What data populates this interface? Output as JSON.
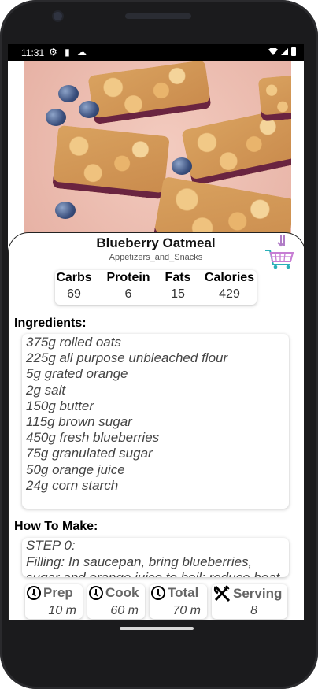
{
  "status": {
    "time": "11:31",
    "left_icons": "⚙ ▮ ☁"
  },
  "recipe": {
    "title": "Blueberry Oatmeal",
    "category": "Appetizers_and_Snacks"
  },
  "macros": [
    {
      "label": "Carbs",
      "value": "69"
    },
    {
      "label": "Protein",
      "value": "6"
    },
    {
      "label": "Fats",
      "value": "15"
    },
    {
      "label": "Calories",
      "value": "429"
    }
  ],
  "ingredients": {
    "heading": "Ingredients:",
    "items": [
      "375g rolled oats",
      "225g all purpose unbleached flour",
      "5g grated orange",
      "2g salt",
      "150g butter",
      "115g brown sugar",
      "450g fresh blueberries",
      "75g granulated sugar",
      "50g orange juice",
      "24g corn starch"
    ]
  },
  "how_to_make": {
    "heading": "How To Make:",
    "step_label": "STEP 0:",
    "step_text": "Filling: In saucepan, bring blueberries, sugar and orange juice to boil; reduce heat and"
  },
  "times": [
    {
      "label": "Prep",
      "value": "10 m",
      "icon": "clock-icon"
    },
    {
      "label": "Cook",
      "value": "60 m",
      "icon": "clock-icon"
    },
    {
      "label": "Total",
      "value": "70 m",
      "icon": "clock-icon"
    },
    {
      "label": "Serving",
      "value": "8",
      "icon": "utensils-icon"
    }
  ],
  "colors": {
    "card_border": "#222222",
    "muted_text": "#444444"
  }
}
